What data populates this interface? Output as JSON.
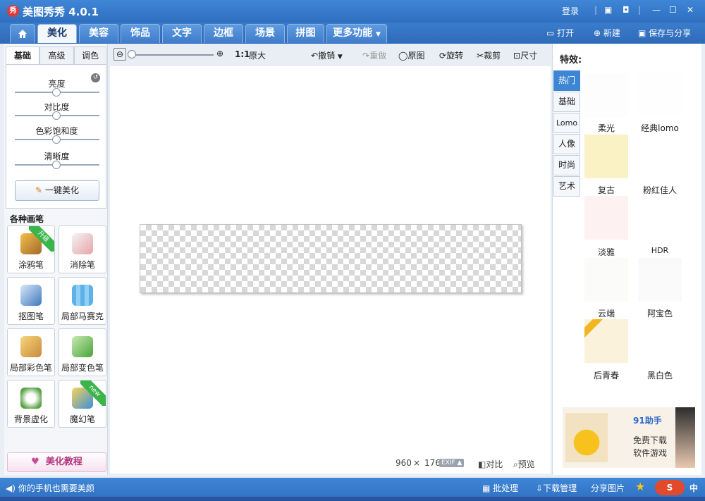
{
  "app": {
    "title": "美图秀秀 4.0.1",
    "logo_char": "秀"
  },
  "window": {
    "login": "登录",
    "minimize": "—",
    "maximize": "☐",
    "close": "✕"
  },
  "nav": {
    "tabs": [
      "美化",
      "美容",
      "饰品",
      "文字",
      "边框",
      "场景",
      "拼图",
      "更多功能"
    ],
    "active": "美化",
    "open": "打开",
    "new": "新建",
    "save_share": "保存与分享"
  },
  "left": {
    "subtabs": [
      "基础",
      "高级",
      "调色"
    ],
    "sliders": [
      {
        "label": "亮度",
        "value": 0.5
      },
      {
        "label": "对比度",
        "value": 0.5
      },
      {
        "label": "色彩饱和度",
        "value": 0.5
      },
      {
        "label": "清晰度",
        "value": 0.5
      }
    ],
    "one_key": "一键美化",
    "brush_title": "各种画笔",
    "brushes": [
      {
        "label": "涂鸦笔",
        "badge": "升级"
      },
      {
        "label": "消除笔"
      },
      {
        "label": "抠图笔"
      },
      {
        "label": "局部马赛克"
      },
      {
        "label": "局部彩色笔"
      },
      {
        "label": "局部变色笔"
      },
      {
        "label": "背景虚化"
      },
      {
        "label": "魔幻笔",
        "badge": "new"
      }
    ],
    "tutorial": "美化教程"
  },
  "toolbar": {
    "zoom_label": "1:1",
    "original_size": "原大",
    "undo": "撤销",
    "redo": "重做",
    "original": "原图",
    "rotate": "旋转",
    "crop": "裁剪",
    "size": "尺寸"
  },
  "canvas": {
    "width": "960",
    "x": "×",
    "height": "176",
    "exif": "EXIF",
    "compare": "对比",
    "preview": "预览"
  },
  "right": {
    "title": "特效:",
    "categories": [
      "热门",
      "基础",
      "Lomo",
      "人像",
      "时尚",
      "艺术"
    ],
    "effects": [
      "柔光",
      "经典lomo",
      "复古",
      "粉红佳人",
      "淡雅",
      "HDR",
      "云端",
      "阿宝色",
      "后青春",
      "黑白色"
    ],
    "ad": {
      "brand": "91助手",
      "text1": "免费下载",
      "text2": "软件游戏"
    }
  },
  "status": {
    "message": "你的手机也需要美颜",
    "batch": "批处理",
    "download": "下载管理",
    "share": "分享图片",
    "ime": "中"
  }
}
